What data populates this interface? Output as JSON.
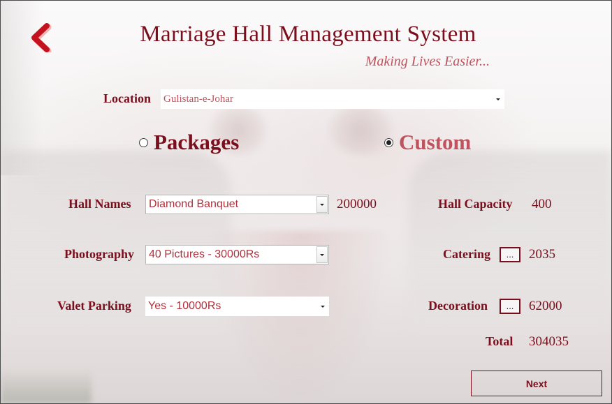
{
  "app": {
    "title": "Marriage Hall Management System",
    "tagline": "Making Lives Easier..."
  },
  "location": {
    "label": "Location",
    "selected": "Gulistan-e-Johar"
  },
  "mode": {
    "packages_label": "Packages",
    "custom_label": "Custom",
    "selected": "Custom"
  },
  "hall": {
    "label": "Hall Names",
    "selected": "Diamond Banquet",
    "price": "200000",
    "capacity_label": "Hall Capacity",
    "capacity": "400"
  },
  "photography": {
    "label": "Photography",
    "selected": "40 Pictures - 30000Rs"
  },
  "catering": {
    "label": "Catering",
    "button": "...",
    "value": "2035"
  },
  "valet": {
    "label": "Valet Parking",
    "selected": "Yes - 10000Rs"
  },
  "decoration": {
    "label": "Decoration",
    "button": "...",
    "value": "62000"
  },
  "total": {
    "label": "Total",
    "value": "304035"
  },
  "next_button": "Next",
  "colors": {
    "accent": "#7a0e1c",
    "tagline": "#c0525e",
    "back_arrow": "#c4121f"
  },
  "icons": {
    "back": "back-arrow-icon",
    "dropdown": "chevron-down-icon"
  }
}
